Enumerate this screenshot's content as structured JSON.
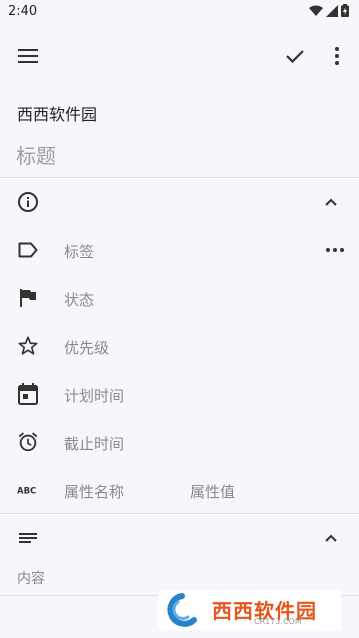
{
  "status_bar": {
    "time": "2:40"
  },
  "toolbar": {
    "menu_icon": "menu-icon",
    "confirm_icon": "check-icon",
    "more_icon": "more-vertical-icon"
  },
  "app_name": "西西软件园",
  "title": {
    "value": "",
    "placeholder": "标题"
  },
  "properties_section": {
    "icon": "info-icon",
    "rows": [
      {
        "icon": "label-icon",
        "label": "标签"
      },
      {
        "icon": "flag-icon",
        "label": "状态"
      },
      {
        "icon": "star-icon",
        "label": "优先级"
      },
      {
        "icon": "calendar-icon",
        "label": "计划时间"
      },
      {
        "icon": "alarm-icon",
        "label": "截止时间"
      },
      {
        "icon": "abc-icon",
        "label": "属性名称",
        "value_label": "属性值"
      }
    ]
  },
  "content_section": {
    "icon": "notes-icon",
    "placeholder": "内容"
  },
  "watermark": {
    "text": "西西软件园",
    "sub": "CR173.COM"
  }
}
